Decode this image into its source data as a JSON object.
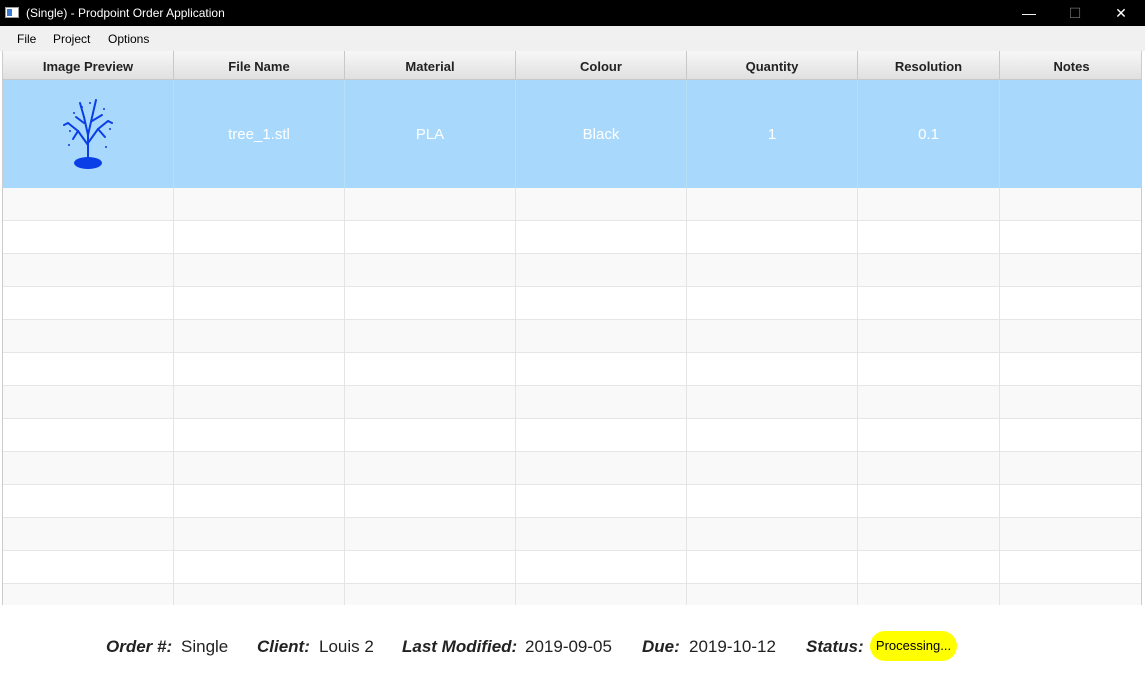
{
  "window": {
    "title": "(Single) - Prodpoint Order Application",
    "min_icon": "minimize-icon",
    "max_icon": "maximize-icon",
    "close_icon": "close-icon"
  },
  "menu": {
    "items": [
      "File",
      "Project",
      "Options"
    ]
  },
  "table": {
    "columns": [
      "Image Preview",
      "File Name",
      "Material",
      "Colour",
      "Quantity",
      "Resolution",
      "Notes"
    ],
    "rows": [
      {
        "preview_icon": "tree-model-icon",
        "file_name": "tree_1.stl",
        "material": "PLA",
        "colour": "Black",
        "quantity": "1",
        "resolution": "0.1",
        "notes": ""
      }
    ],
    "selected_row_color": "#a8d9fc"
  },
  "status_bar": {
    "order_label": "Order #:",
    "order_value": "Single",
    "client_label": "Client:",
    "client_value": "Louis 2",
    "modified_label": "Last Modified:",
    "modified_value": "2019-09-05",
    "due_label": "Due:",
    "due_value": "2019-10-12",
    "status_label": "Status:",
    "status_value": "Processing...",
    "status_color": "#ffff00"
  }
}
